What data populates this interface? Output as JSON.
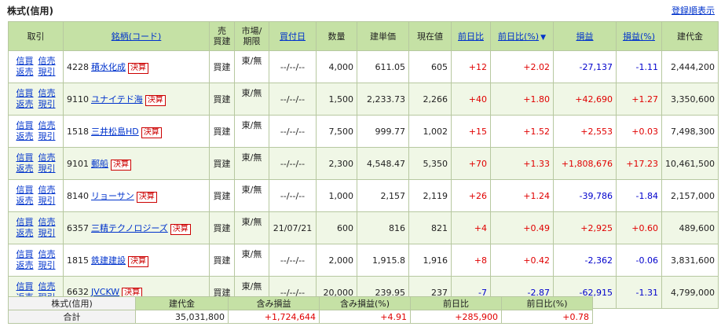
{
  "page_title": "株式(信用)",
  "sort_link": "登録順表示",
  "headers": {
    "actions": "取引",
    "name": "銘柄(コード)",
    "type": "売\n買建",
    "market": "市場/\n期限",
    "buy_date": "買付日",
    "qty": "数量",
    "cost": "建単価",
    "price": "現在値",
    "change": "前日比",
    "change_pct": "前日比(%)",
    "sort_mark": "▼",
    "pl": "損益",
    "pl_pct": "損益(%)",
    "amount": "建代金"
  },
  "actions": {
    "buy": "信買",
    "sell": "信売",
    "repay": "返売",
    "actual": "現引"
  },
  "badge": "決算",
  "rows": [
    {
      "code": "4228",
      "name": "積水化成",
      "type": "買建",
      "market": "東/無",
      "date": "--/--/--",
      "qty": "4,000",
      "cost": "611.05",
      "price": "605",
      "change": "+12",
      "change_pct": "+2.02",
      "pl": "-27,137",
      "pl_pct": "-1.11",
      "amount": "2,444,200"
    },
    {
      "code": "9110",
      "name": "ユナイテド海",
      "type": "買建",
      "market": "東/無",
      "date": "--/--/--",
      "qty": "1,500",
      "cost": "2,233.73",
      "price": "2,266",
      "change": "+40",
      "change_pct": "+1.80",
      "pl": "+42,690",
      "pl_pct": "+1.27",
      "amount": "3,350,600"
    },
    {
      "code": "1518",
      "name": "三井松島HD",
      "type": "買建",
      "market": "東/無",
      "date": "--/--/--",
      "qty": "7,500",
      "cost": "999.77",
      "price": "1,002",
      "change": "+15",
      "change_pct": "+1.52",
      "pl": "+2,553",
      "pl_pct": "+0.03",
      "amount": "7,498,300"
    },
    {
      "code": "9101",
      "name": "郵船",
      "type": "買建",
      "market": "東/無",
      "date": "--/--/--",
      "qty": "2,300",
      "cost": "4,548.47",
      "price": "5,350",
      "change": "+70",
      "change_pct": "+1.33",
      "pl": "+1,808,676",
      "pl_pct": "+17.23",
      "amount": "10,461,500"
    },
    {
      "code": "8140",
      "name": "リョーサン",
      "type": "買建",
      "market": "東/無",
      "date": "--/--/--",
      "qty": "1,000",
      "cost": "2,157",
      "price": "2,119",
      "change": "+26",
      "change_pct": "+1.24",
      "pl": "-39,786",
      "pl_pct": "-1.84",
      "amount": "2,157,000"
    },
    {
      "code": "6357",
      "name": "三精テクノロジーズ",
      "type": "買建",
      "market": "東/無",
      "date": "21/07/21",
      "qty": "600",
      "cost": "816",
      "price": "821",
      "change": "+4",
      "change_pct": "+0.49",
      "pl": "+2,925",
      "pl_pct": "+0.60",
      "amount": "489,600"
    },
    {
      "code": "1815",
      "name": "鉄建建設",
      "type": "買建",
      "market": "東/無",
      "date": "--/--/--",
      "qty": "2,000",
      "cost": "1,915.8",
      "price": "1,916",
      "change": "+8",
      "change_pct": "+0.42",
      "pl": "-2,362",
      "pl_pct": "-0.06",
      "amount": "3,831,600"
    },
    {
      "code": "6632",
      "name": "JVCKW",
      "type": "買建",
      "market": "東/無",
      "date": "--/--/--",
      "qty": "20,000",
      "cost": "239.95",
      "price": "237",
      "change": "-7",
      "change_pct": "-2.87",
      "pl": "-62,915",
      "pl_pct": "-1.31",
      "amount": "4,799,000"
    }
  ],
  "summary": {
    "label_top": "株式(信用)",
    "label_bottom": "合計",
    "headers": [
      "建代金",
      "含み損益",
      "含み損益(%)",
      "前日比",
      "前日比(%)"
    ],
    "values": [
      "35,031,800",
      "+1,724,644",
      "+4.91",
      "+285,900",
      "+0.78"
    ]
  }
}
